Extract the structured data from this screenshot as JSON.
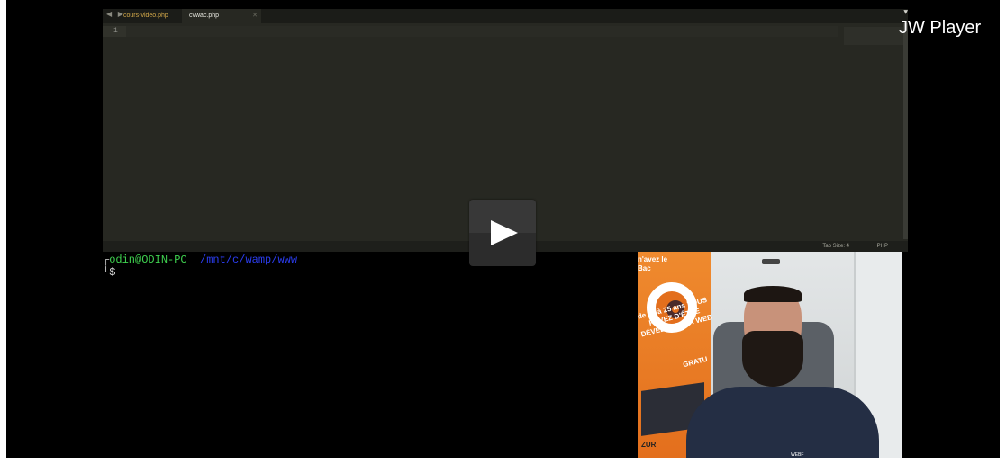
{
  "editor": {
    "tabs": [
      {
        "label": "cours-video.php"
      },
      {
        "label": "cvwac.php"
      }
    ],
    "line_number": "1",
    "status": {
      "tab_size": "Tab Size: 4",
      "syntax": "PHP"
    }
  },
  "terminal": {
    "corner_top": "┌",
    "user": "odin@ODIN-PC",
    "path": "/mnt/c/wamp/www",
    "prompt": "└$"
  },
  "webcam": {
    "banner_top": "n'avez le Bac",
    "banner_main": "de 18 à 25 ans VOUS RÊVEZ D'ÊTRE DÉVELOPPEUR WEB",
    "banner_gratuit": "GRATU",
    "banner_bottom": "ZUR",
    "shirt_logo": "WEBF"
  },
  "player": {
    "watermark": "JW Player",
    "play_icon": "play-icon"
  },
  "colors": {
    "editor_bg": "#272822",
    "terminal_user": "#3fd14f",
    "terminal_path": "#2b3df0",
    "banner_orange": "#e36f1d"
  }
}
